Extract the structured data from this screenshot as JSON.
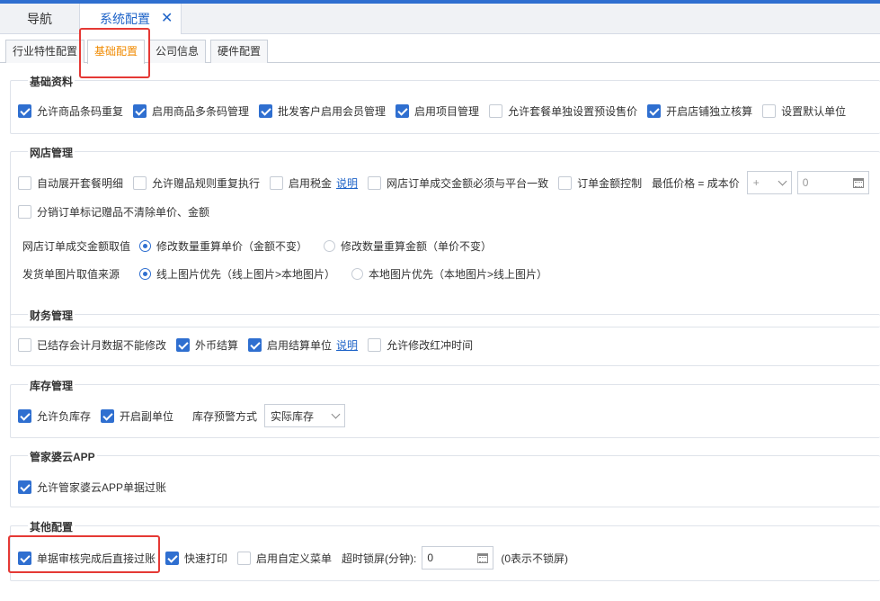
{
  "tabs": {
    "nav": "导航",
    "active": "系统配置",
    "close": "✕"
  },
  "subtabs": [
    "行业特性配置",
    "基础配置",
    "公司信息",
    "硬件配置"
  ],
  "basic": {
    "title": "基础资料",
    "items": [
      {
        "label": "允许商品条码重复",
        "checked": true
      },
      {
        "label": "启用商品多条码管理",
        "checked": true
      },
      {
        "label": "批发客户启用会员管理",
        "checked": true
      },
      {
        "label": "启用项目管理",
        "checked": true
      },
      {
        "label": "允许套餐单独设置预设售价",
        "checked": false
      },
      {
        "label": "开启店铺独立核算",
        "checked": true
      },
      {
        "label": "设置默认单位",
        "checked": false
      }
    ]
  },
  "online": {
    "title": "网店管理",
    "row1": [
      {
        "label": "自动展开套餐明细",
        "checked": false
      },
      {
        "label": "允许赠品规则重复执行",
        "checked": false
      },
      {
        "label": "启用税金",
        "checked": false,
        "link": "说明"
      },
      {
        "label": "网店订单成交金额必须与平台一致",
        "checked": false
      },
      {
        "label": "订单金额控制",
        "checked": false
      }
    ],
    "price_label": "最低价格 = 成本价",
    "price_op": "+",
    "price_value": "0",
    "row2": [
      {
        "label": "分销订单标记赠品不清除单价、金额",
        "checked": false
      }
    ],
    "amount_label": "网店订单成交金额取值",
    "amount_options": [
      {
        "label": "修改数量重算单价（金额不变）",
        "selected": true
      },
      {
        "label": "修改数量重算金额（单价不变）",
        "selected": false
      }
    ],
    "image_label": "发货单图片取值来源",
    "image_options": [
      {
        "label": "线上图片优先（线上图片>本地图片）",
        "selected": true
      },
      {
        "label": "本地图片优先（本地图片>线上图片）",
        "selected": false
      }
    ]
  },
  "finance": {
    "title": "财务管理",
    "items": [
      {
        "label": "已结存会计月数据不能修改",
        "checked": false
      },
      {
        "label": "外币结算",
        "checked": true
      },
      {
        "label": "启用结算单位",
        "checked": true,
        "link": "说明"
      },
      {
        "label": "允许修改红冲时间",
        "checked": false
      }
    ]
  },
  "stock": {
    "title": "库存管理",
    "items": [
      {
        "label": "允许负库存",
        "checked": true
      },
      {
        "label": "开启副单位",
        "checked": true
      }
    ],
    "warn_label": "库存预警方式",
    "warn_value": "实际库存"
  },
  "app": {
    "title": "管家婆云APP",
    "items": [
      {
        "label": "允许管家婆云APP单据过账",
        "checked": true
      }
    ]
  },
  "other": {
    "title": "其他配置",
    "items": [
      {
        "label": "单据审核完成后直接过账",
        "checked": true
      },
      {
        "label": "快速打印",
        "checked": true
      },
      {
        "label": "启用自定义菜单",
        "checked": false
      }
    ],
    "lock_label": "超时锁屏(分钟):",
    "lock_value": "0",
    "lock_note": "(0表示不锁屏)"
  },
  "colors": {
    "accent": "#2f6fd0",
    "highlight": "#e53935",
    "active_subtab": "#f08a00"
  }
}
